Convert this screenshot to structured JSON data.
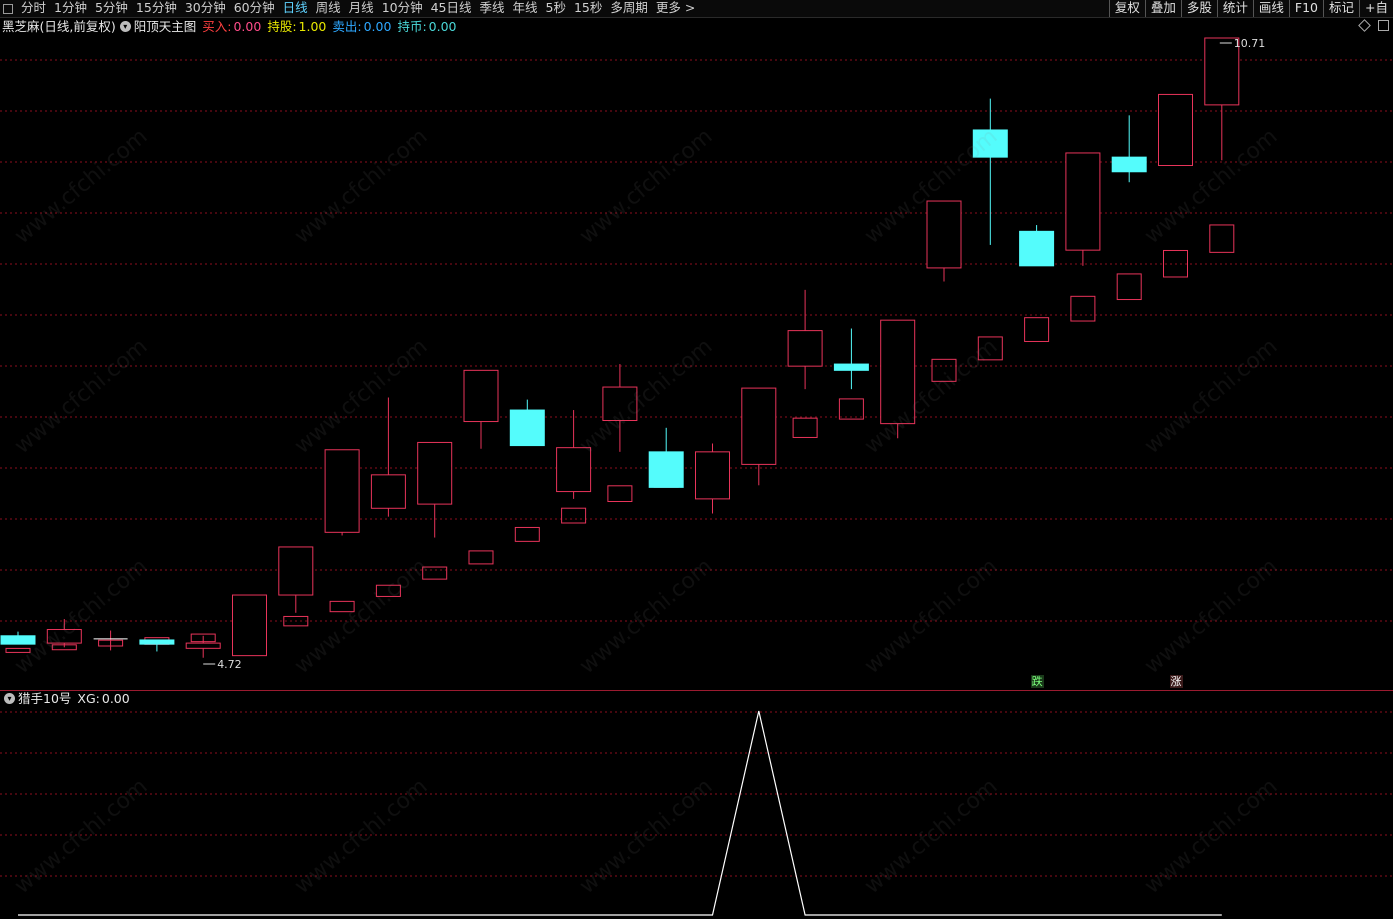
{
  "toolbar": {
    "periods": [
      "分时",
      "1分钟",
      "5分钟",
      "15分钟",
      "30分钟",
      "60分钟",
      "日线",
      "周线",
      "月线",
      "10分钟",
      "45日线",
      "季线",
      "年线",
      "5秒",
      "15秒",
      "多周期",
      "更多 >"
    ],
    "active_period": "日线",
    "actions": [
      "复权",
      "叠加",
      "多股",
      "统计",
      "画线",
      "F10",
      "标记",
      "+自"
    ]
  },
  "main_header": {
    "stock": "黑芝麻(日线,前复权)",
    "indicator": "阳顶天主图",
    "buy_label": "买入:",
    "buy_value": "0.00",
    "hold_label": "持股:",
    "hold_value": "1.00",
    "sell_label": "卖出:",
    "sell_value": "0.00",
    "coin_label": "持币:",
    "coin_value": "0.00"
  },
  "sub_header": {
    "indicator": "猎手10号",
    "xg_label": "XG:",
    "xg_value": "0.00"
  },
  "annotations": {
    "high": "10.71",
    "low": "4.72",
    "fall_badge": "跌",
    "rise_badge": "涨"
  },
  "watermark": "www.cfchi.com",
  "colors": {
    "up": "#e8345a",
    "down": "#54fcfc",
    "box": "#e8345a",
    "grid": "#8b0e1e",
    "line": "#ffffff"
  },
  "chart_data": {
    "type": "candlestick",
    "price_range": [
      4.72,
      10.71
    ],
    "candles": [
      {
        "o": 4.99,
        "c": 4.91,
        "h": 5.03,
        "l": 4.91
      },
      {
        "o": 4.92,
        "c": 5.05,
        "h": 5.15,
        "l": 4.88
      },
      {
        "o": 4.96,
        "c": 4.96,
        "h": 5.04,
        "l": 4.85
      },
      {
        "o": 4.95,
        "c": 4.91,
        "h": 4.95,
        "l": 4.84
      },
      {
        "o": 4.87,
        "c": 4.92,
        "h": 4.99,
        "l": 4.78
      },
      {
        "o": 4.8,
        "c": 5.38,
        "h": 5.38,
        "l": 4.8
      },
      {
        "o": 5.38,
        "c": 5.84,
        "h": 5.84,
        "l": 5.21
      },
      {
        "o": 5.98,
        "c": 6.77,
        "h": 6.77,
        "l": 5.95
      },
      {
        "o": 6.21,
        "c": 6.53,
        "h": 7.27,
        "l": 6.13
      },
      {
        "o": 6.25,
        "c": 6.84,
        "h": 6.84,
        "l": 5.93
      },
      {
        "o": 7.04,
        "c": 7.53,
        "h": 7.53,
        "l": 6.78
      },
      {
        "o": 7.15,
        "c": 6.81,
        "h": 7.25,
        "l": 6.81
      },
      {
        "o": 6.37,
        "c": 6.79,
        "h": 7.15,
        "l": 6.3
      },
      {
        "o": 7.05,
        "c": 7.37,
        "h": 7.59,
        "l": 6.75
      },
      {
        "o": 6.75,
        "c": 6.41,
        "h": 6.98,
        "l": 6.41
      },
      {
        "o": 6.3,
        "c": 6.75,
        "h": 6.83,
        "l": 6.16
      },
      {
        "o": 6.63,
        "c": 7.36,
        "h": 7.36,
        "l": 6.43
      },
      {
        "o": 7.57,
        "c": 7.91,
        "h": 8.3,
        "l": 7.35
      },
      {
        "o": 7.59,
        "c": 7.53,
        "h": 7.93,
        "l": 7.35
      },
      {
        "o": 7.02,
        "c": 8.01,
        "h": 8.01,
        "l": 6.88
      },
      {
        "o": 8.51,
        "c": 9.15,
        "h": 9.15,
        "l": 8.38
      },
      {
        "o": 9.83,
        "c": 9.57,
        "h": 10.13,
        "l": 8.73
      },
      {
        "o": 8.86,
        "c": 8.53,
        "h": 8.92,
        "l": 8.53
      },
      {
        "o": 8.68,
        "c": 9.61,
        "h": 9.61,
        "l": 8.53
      },
      {
        "o": 9.57,
        "c": 9.43,
        "h": 9.97,
        "l": 9.33
      },
      {
        "o": 9.49,
        "c": 10.17,
        "h": 10.17,
        "l": 9.49
      },
      {
        "o": 10.07,
        "c": 10.71,
        "h": 10.71,
        "l": 9.54
      }
    ],
    "boxes": [
      4.85,
      4.88,
      4.92,
      4.94,
      4.97,
      5.04,
      5.13,
      5.27,
      5.42,
      5.59,
      5.74,
      5.96,
      6.14,
      6.35,
      6.49,
      6.64,
      6.83,
      6.98,
      7.16,
      7.35,
      7.53,
      7.74,
      7.92,
      8.12,
      8.33,
      8.55,
      8.79
    ],
    "sub_line": [
      0,
      0,
      0,
      0,
      0,
      0,
      0,
      0,
      0,
      0,
      0,
      0,
      0,
      0,
      0,
      0,
      1,
      0,
      0,
      0,
      0,
      0,
      0,
      0,
      0,
      0,
      0
    ],
    "markers": [
      {
        "index": 22,
        "label": "跌"
      },
      {
        "index": 25,
        "label": "涨"
      }
    ]
  }
}
